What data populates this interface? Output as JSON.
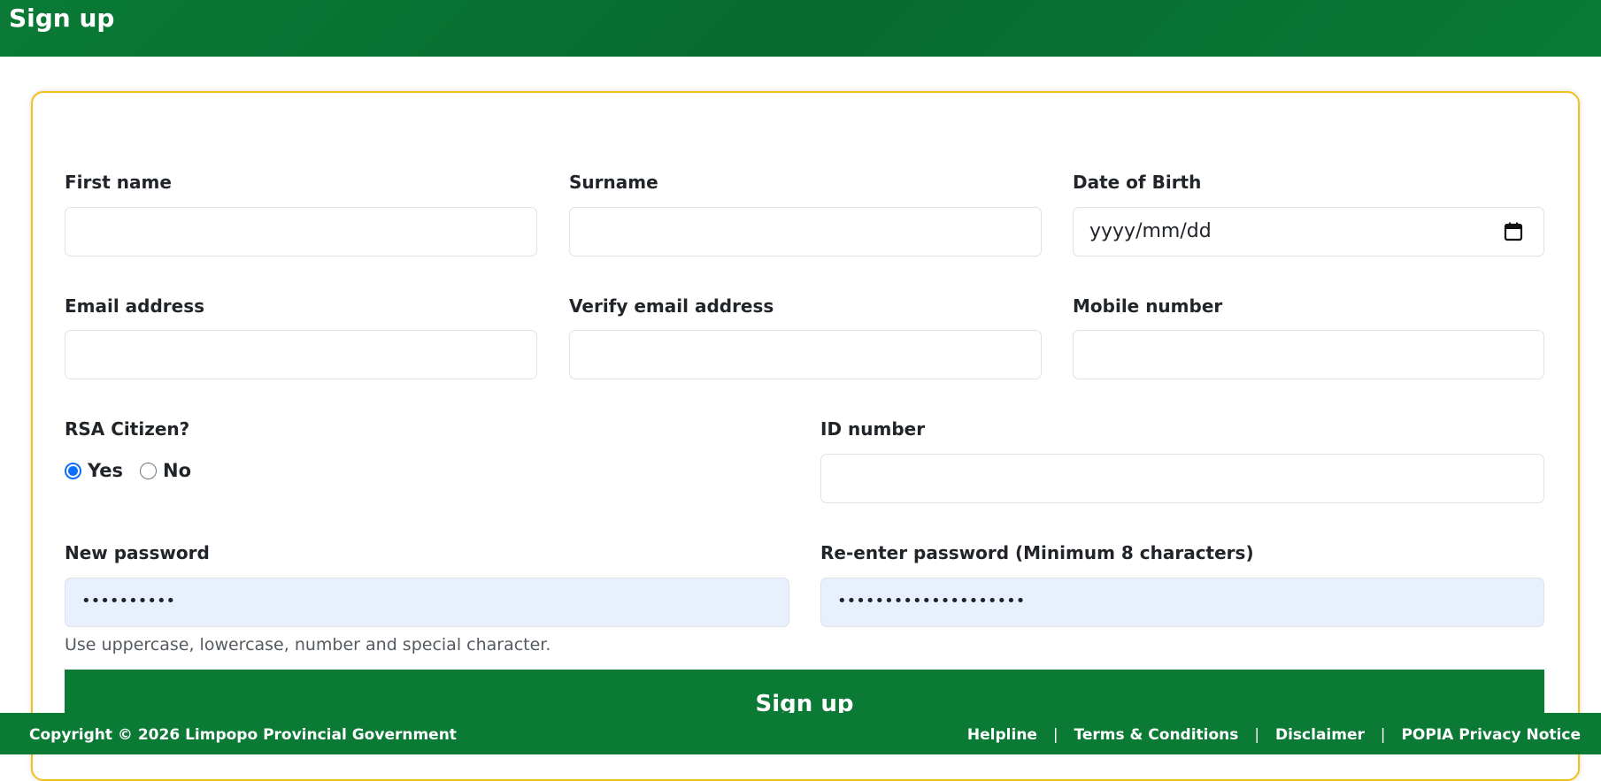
{
  "header": {
    "title": "Sign up"
  },
  "form": {
    "first_name": {
      "label": "First name",
      "value": ""
    },
    "surname": {
      "label": "Surname",
      "value": ""
    },
    "dob": {
      "label": "Date of Birth",
      "placeholder": "yyyy/mm/dd",
      "icon": "calendar-icon"
    },
    "email": {
      "label": "Email address",
      "value": ""
    },
    "verify_email": {
      "label": "Verify email address",
      "value": ""
    },
    "mobile": {
      "label": "Mobile number",
      "value": ""
    },
    "citizen": {
      "label": "RSA Citizen?",
      "options": [
        {
          "label": "Yes",
          "selected": true
        },
        {
          "label": "No",
          "selected": false
        }
      ]
    },
    "id_number": {
      "label": "ID number",
      "value": ""
    },
    "new_password": {
      "label": "New password",
      "masked": "••••••••••",
      "autofill_color": "#e8f0fe"
    },
    "reenter_password": {
      "label": "Re-enter password (Minimum 8 characters)",
      "masked": "••••••••••••••••••••",
      "autofill_color": "#e8f0fe"
    },
    "password_hint": "Use uppercase, lowercase, number and special character.",
    "submit_label": "Sign up"
  },
  "footer": {
    "copyright": "Copyright © 2026 Limpopo Provincial Government",
    "links": [
      "Helpline",
      "Terms & Conditions",
      "Disclaimer",
      "POPIA Privacy Notice"
    ],
    "separator": "|"
  },
  "colors": {
    "brand_green": "#0b7a35",
    "card_border": "#f2c01d",
    "radio_accent": "#0d6efd"
  }
}
